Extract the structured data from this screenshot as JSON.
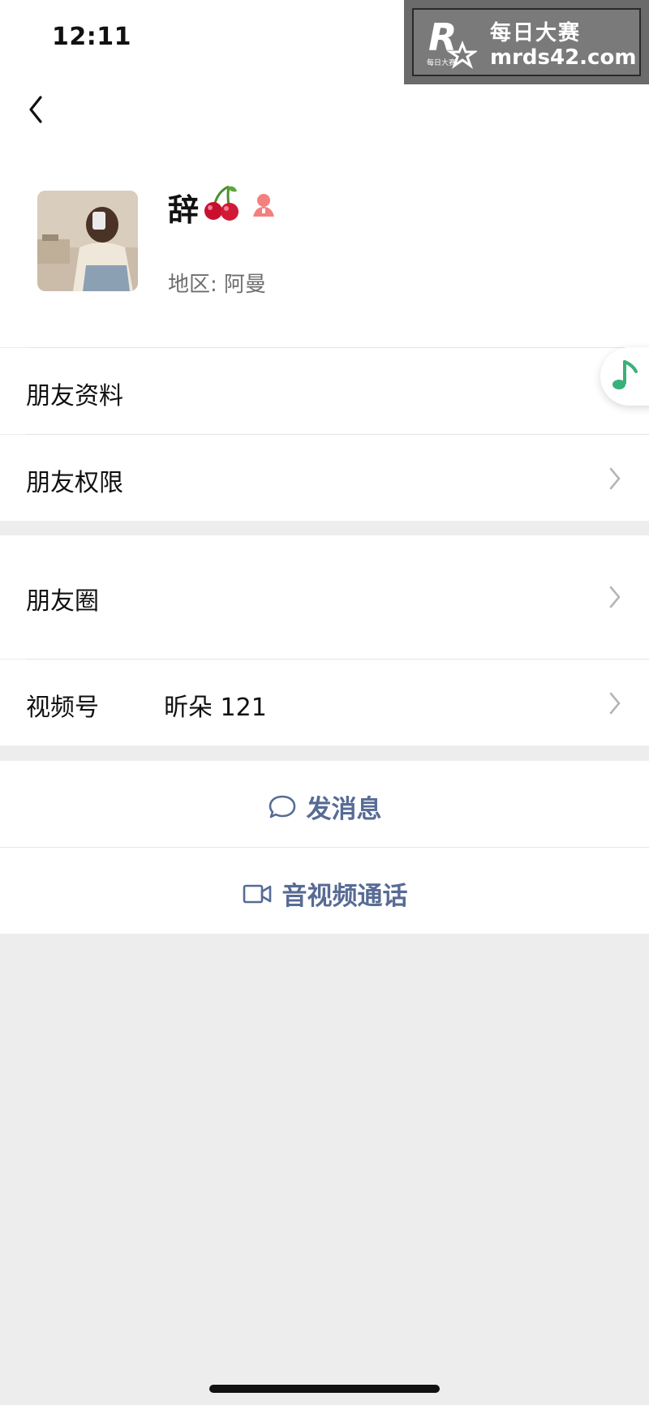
{
  "status_bar": {
    "time": "12:11"
  },
  "watermark": {
    "line1": "每日大赛",
    "line2": "mrds42.com",
    "logo_letter": "R",
    "logo_small": "每日大赛"
  },
  "nav": {
    "back_icon": "chevron-left-icon"
  },
  "profile": {
    "name": "辞",
    "name_emoji_icon": "cherry-icon",
    "gender_icon": "female-icon",
    "region": "地区: 阿曼"
  },
  "menu": {
    "friend_profile": "朋友资料",
    "friend_permissions": "朋友权限",
    "moments": "朋友圈",
    "channels_label": "视频号",
    "channels_value": "昕朵 121"
  },
  "actions": {
    "send_message": "发消息",
    "video_call": "音视频通话"
  },
  "colors": {
    "link": "#576b95",
    "background": "#ededed",
    "accent_green": "#3ab07a"
  }
}
